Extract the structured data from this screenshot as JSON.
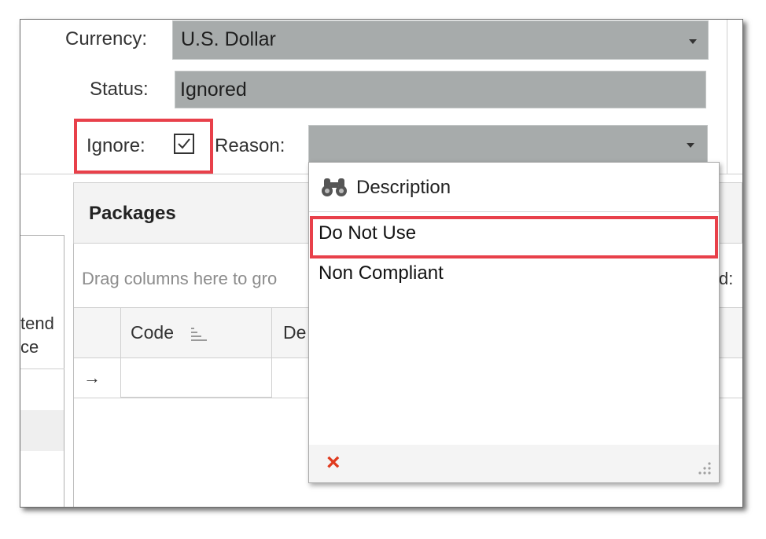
{
  "form": {
    "currency_label": "Currency:",
    "currency_value": "U.S. Dollar",
    "status_label": "Status:",
    "status_value": "Ignored",
    "ignore_label": "Ignore:",
    "ignore_checked": true,
    "reason_label": "Reason:",
    "reason_value": ""
  },
  "packages": {
    "title": "Packages",
    "drag_hint": "Drag columns here to gro",
    "right_partial": "d:",
    "columns": [
      "Code",
      "De"
    ],
    "row_indicator": "→"
  },
  "left_grid": {
    "partial_header_line1": "tend",
    "partial_header_line2": "ce"
  },
  "reason_dropdown": {
    "header": "Description",
    "items": [
      "Do Not Use",
      "Non Compliant"
    ],
    "clear_symbol": "×"
  },
  "colors": {
    "highlight": "#e8404a",
    "field_bg": "#a7abab",
    "clear_icon": "#e03a1e"
  }
}
